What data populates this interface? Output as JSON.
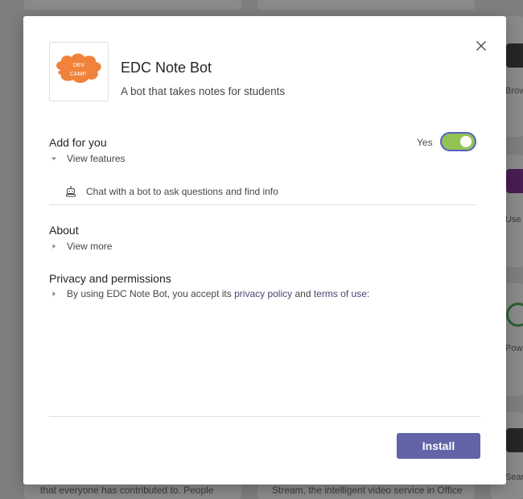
{
  "background": {
    "right_card_texts": [
      "Brov",
      "Use",
      "Pow",
      "Sear"
    ],
    "bottom_left_text": "that everyone has contributed to. People",
    "bottom_mid_text": "Stream, the intelligent video service in Office"
  },
  "app": {
    "logo_text_line1": "DEV",
    "logo_text_line2": "CAMP",
    "name": "EDC Note Bot",
    "description": "A bot that takes notes for students"
  },
  "add_for_you": {
    "title": "Add for you",
    "toggle_label": "Yes",
    "toggle_on": true,
    "view_features_label": "View features",
    "features": [
      "Chat with a bot to ask questions and find info"
    ]
  },
  "about": {
    "title": "About",
    "view_more_label": "View more"
  },
  "privacy": {
    "title": "Privacy and permissions",
    "text_before": "By using EDC Note Bot, you accept its ",
    "privacy_link": "privacy policy",
    "text_and": " and ",
    "terms_link": "terms of use:"
  },
  "footer": {
    "install_label": "Install"
  },
  "colors": {
    "accent": "#6264a7",
    "toggle_on": "#92c353",
    "logo_orange": "#f0823b"
  }
}
